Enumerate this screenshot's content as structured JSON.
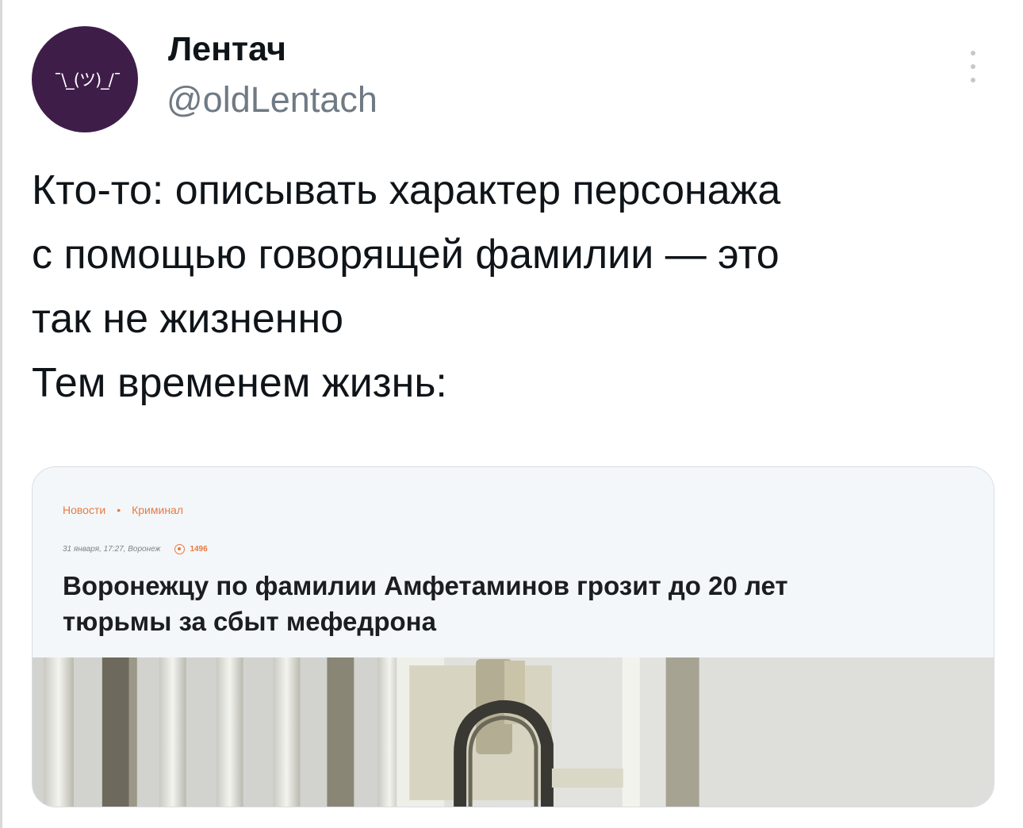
{
  "tweet": {
    "author": {
      "display_name": "Лентач",
      "handle": "@oldLentach",
      "avatar_text": "¯\\_(ツ)_/¯"
    },
    "text_lines": [
      "Кто-то: описывать характер персонажа",
      "с помощью говорящей фамилии — это",
      "так не жизненно",
      "Тем временем жизнь:"
    ]
  },
  "article": {
    "breadcrumb": [
      "Новости",
      "Криминал"
    ],
    "breadcrumb_separator": "•",
    "meta": "31 января, 17:27, Воронеж",
    "views": "1496",
    "headline_lines": [
      "Воронежцу по фамилии Амфетаминов грозит до 20 лет",
      "тюрьмы за сбыт мефедрона"
    ]
  },
  "icons": {
    "more": "vertical-ellipsis",
    "views": "eye-icon"
  },
  "colors": {
    "avatar_bg": "#3f1d49",
    "handle": "#6f7a84",
    "article_accent": "#e87a43",
    "article_header_bg": "#f3f7f9"
  }
}
